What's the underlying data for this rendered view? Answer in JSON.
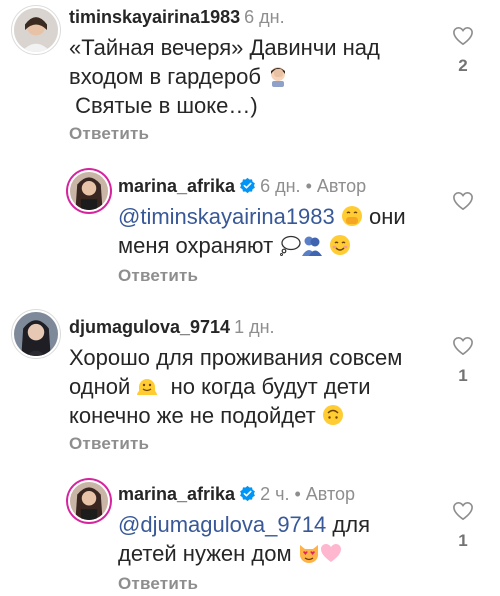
{
  "comments": [
    {
      "username": "timinskayairina1983",
      "time": "6 дн.",
      "line1": "«Тайная вечеря» Давинчи над",
      "line2": "входом в гардероб",
      "line3": " Святые в шоке…)",
      "emoji1": "woman-facepalming-emoji",
      "reply": "Ответить",
      "likes": "2"
    },
    {
      "username": "marina_afrika",
      "time": "6 дн.",
      "author": "• Автор",
      "mention": "@timinskayairina1983",
      "line1_after": "они",
      "line2": "меня охраняют",
      "emoji1": "face-with-hand-over-mouth-emoji",
      "emoji2": "thought-balloon-emoji",
      "emoji3": "people-hugging-emoji",
      "emoji4": "smiling-face-emoji",
      "reply": "Ответить",
      "likes": ""
    },
    {
      "username": "djumagulova_9714",
      "time": "1 дн.",
      "line1": "Хорошо для проживания совсем",
      "line2a": "одной",
      "line2b": "но когда будут дети",
      "line3": "конечно же не подойдет",
      "emoji1": "melting-face-emoji",
      "emoji2": "upside-down-face-emoji",
      "reply": "Ответить",
      "likes": "1"
    },
    {
      "username": "marina_afrika",
      "time": "2 ч.",
      "author": "• Автор",
      "mention": "@djumagulova_9714",
      "line1_after": "для",
      "line2": "детей нужен дом",
      "emoji1": "heart-eyes-cat-emoji",
      "emoji2": "pink-heart-emoji",
      "reply": "Ответить",
      "likes": "1"
    }
  ],
  "colors": {
    "text": "#262626",
    "secondary": "#8e8e8e",
    "mention": "#385898",
    "verified": "#0095f6"
  }
}
